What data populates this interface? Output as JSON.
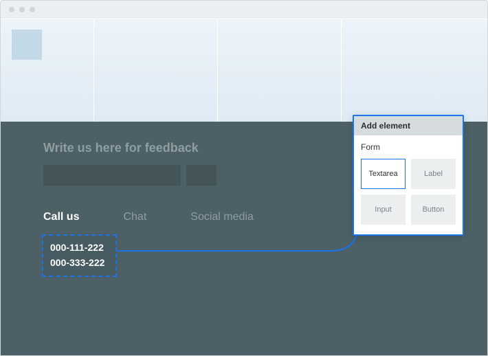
{
  "feedback": {
    "title": "Write us here for feedback"
  },
  "tabs": {
    "call": "Call us",
    "chat": "Chat",
    "social": "Social media"
  },
  "phones": {
    "p1": "000-111-222",
    "p2": "000-333-222"
  },
  "popover": {
    "title": "Add element",
    "section": "Form",
    "items": {
      "textarea": "Textarea",
      "label": "Label",
      "input": "Input",
      "button": "Button"
    }
  }
}
